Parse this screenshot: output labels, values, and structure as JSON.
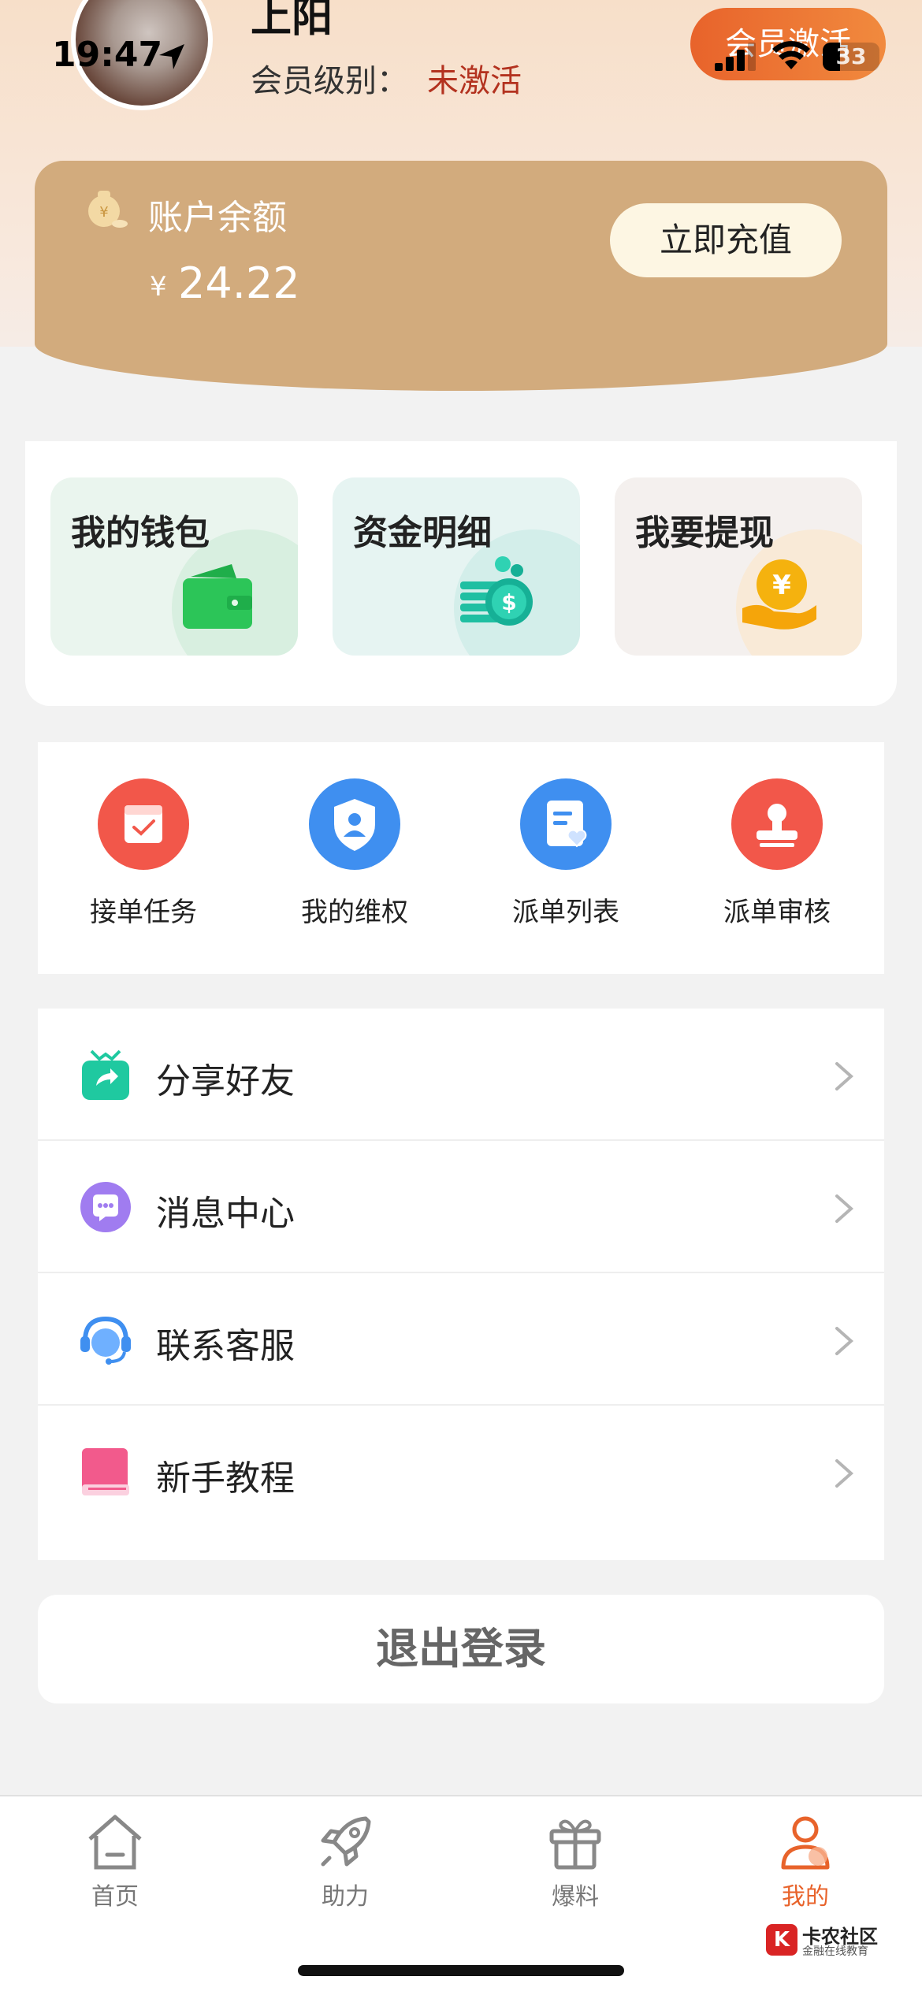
{
  "status_bar": {
    "time": "19:47",
    "battery": "33"
  },
  "profile": {
    "name": "上阳",
    "level_label": "会员级别：",
    "level_value": "未激活",
    "activate_button": "会员激活"
  },
  "balance": {
    "label": "账户余额",
    "currency": "¥",
    "amount": "24.22",
    "recharge_button": "立即充值"
  },
  "wallet_cards": [
    {
      "label": "我的钱包",
      "icon": "wallet-icon",
      "bg": "#eaf5ee",
      "blob": "#d8efe0"
    },
    {
      "label": "资金明细",
      "icon": "coin-stack-icon",
      "bg": "#e6f4f2",
      "blob": "#d3eeea"
    },
    {
      "label": "我要提现",
      "icon": "withdraw-hand-icon",
      "bg": "#f4f0ee",
      "blob": "#f9ead7"
    }
  ],
  "quick_actions": [
    {
      "label": "接单任务",
      "icon": "task-calendar-icon",
      "color": "#f2574a"
    },
    {
      "label": "我的维权",
      "icon": "shield-user-icon",
      "color": "#3f8ff0"
    },
    {
      "label": "派单列表",
      "icon": "document-heart-icon",
      "color": "#3f8ff0"
    },
    {
      "label": "派单审核",
      "icon": "stamp-icon",
      "color": "#f2574a"
    }
  ],
  "menu": [
    {
      "label": "分享好友",
      "icon": "share-gift-icon",
      "color": "#1fc9a0"
    },
    {
      "label": "消息中心",
      "icon": "message-bubble-icon",
      "color": "#a07cf0"
    },
    {
      "label": "联系客服",
      "icon": "headset-icon",
      "color": "#3f8ff0"
    },
    {
      "label": "新手教程",
      "icon": "book-icon",
      "color": "#f25a8c"
    }
  ],
  "logout_button": "退出登录",
  "tabs": [
    {
      "label": "首页",
      "icon": "home-icon",
      "active": false
    },
    {
      "label": "助力",
      "icon": "rocket-icon",
      "active": false
    },
    {
      "label": "爆料",
      "icon": "gift-box-icon",
      "active": false
    },
    {
      "label": "我的",
      "icon": "user-icon",
      "active": true
    }
  ],
  "watermark": {
    "mark": "K",
    "title": "卡农社区",
    "subtitle": "金融在线教育"
  }
}
